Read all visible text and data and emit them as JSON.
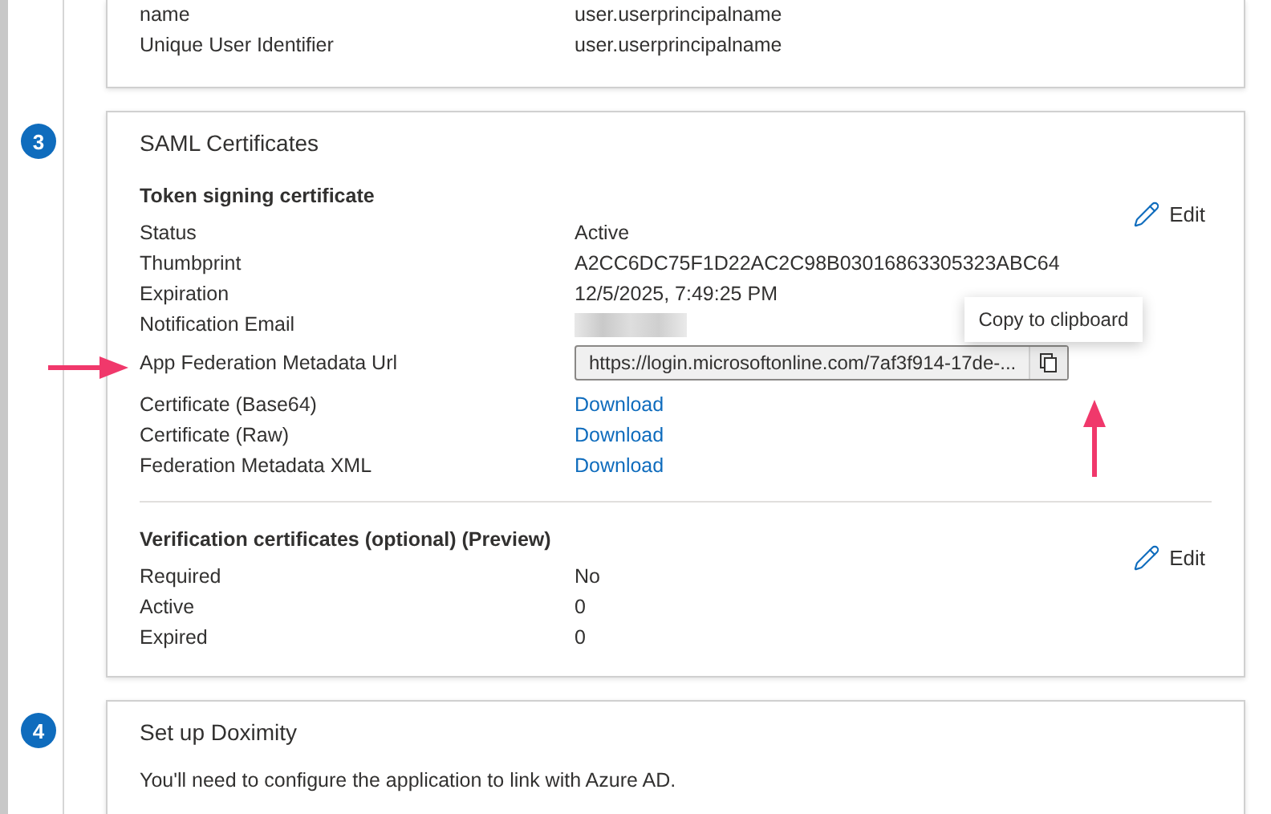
{
  "claims_card": {
    "rows": [
      {
        "label": "name",
        "value": "user.userprincipalname"
      },
      {
        "label": "Unique User Identifier",
        "value": "user.userprincipalname"
      }
    ]
  },
  "saml_certificates": {
    "step": "3",
    "title": "SAML Certificates",
    "token_signing": {
      "heading": "Token signing certificate",
      "edit_label": "Edit",
      "rows": [
        {
          "kind": "text",
          "label": "Status",
          "value": "Active"
        },
        {
          "kind": "text",
          "label": "Thumbprint",
          "value": "A2CC6DC75F1D22AC2C98B03016863305323ABC64"
        },
        {
          "kind": "text",
          "label": "Expiration",
          "value": "12/5/2025, 7:49:25 PM"
        },
        {
          "kind": "redacted",
          "label": "Notification Email"
        },
        {
          "kind": "url",
          "label": "App Federation Metadata Url",
          "value": "https://login.microsoftonline.com/7af3f914-17de-...",
          "tooltip": "Copy to clipboard"
        },
        {
          "kind": "link",
          "label": "Certificate (Base64)",
          "value": "Download"
        },
        {
          "kind": "link",
          "label": "Certificate (Raw)",
          "value": "Download"
        },
        {
          "kind": "link",
          "label": "Federation Metadata XML",
          "value": "Download"
        }
      ]
    },
    "verification": {
      "heading": "Verification certificates (optional) (Preview)",
      "edit_label": "Edit",
      "rows": [
        {
          "kind": "text",
          "label": "Required",
          "value": "No"
        },
        {
          "kind": "text",
          "label": "Active",
          "value": "0"
        },
        {
          "kind": "text",
          "label": "Expired",
          "value": "0"
        }
      ]
    }
  },
  "setup": {
    "step": "4",
    "title": "Set up Doximity",
    "description": "You'll need to configure the application to link with Azure AD."
  }
}
